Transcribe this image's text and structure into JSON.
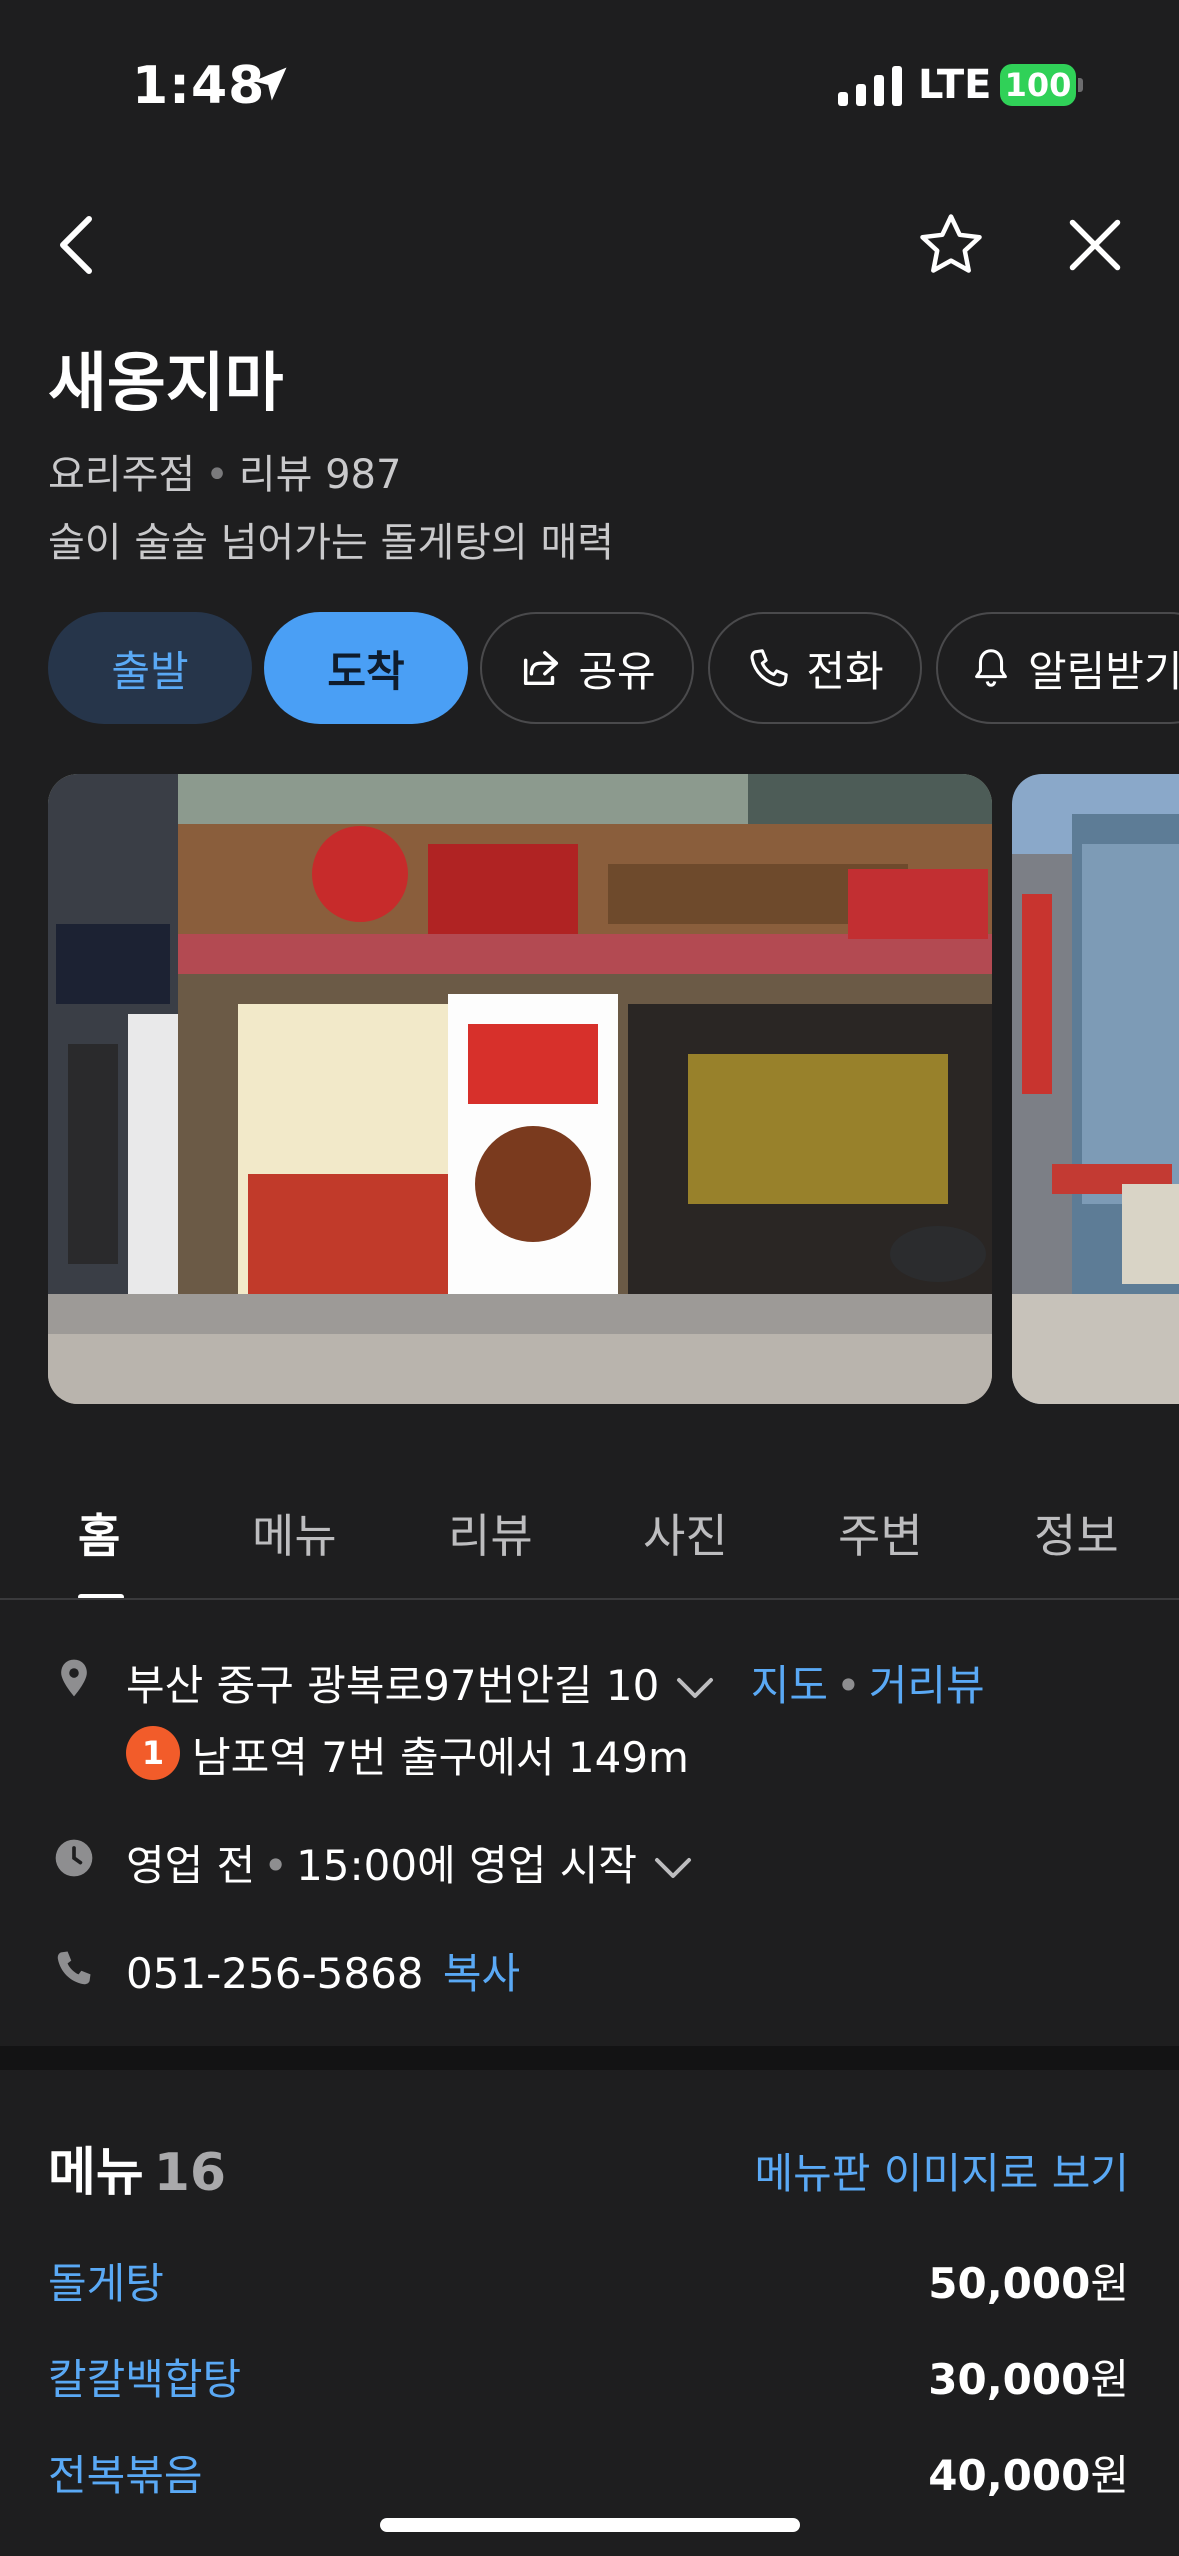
{
  "status_bar": {
    "time": "1:48",
    "network": "LTE",
    "battery": "100"
  },
  "place": {
    "name": "새옹지마",
    "category": "요리주점",
    "reviews_label": "리뷰 987",
    "tagline": "술이 술술 넘어가는 돌게탕의 매력"
  },
  "actions": {
    "depart": "출발",
    "arrive": "도착",
    "share": "공유",
    "call": "전화",
    "notify": "알림받기"
  },
  "tabs": [
    "홈",
    "메뉴",
    "리뷰",
    "사진",
    "주변",
    "정보"
  ],
  "info": {
    "address": "부산 중구 광복로97번안길 10",
    "map_link": "지도",
    "street_view_link": "거리뷰",
    "transit_badge": "1",
    "transit": "남포역 7번 출구에서 149m",
    "hours": "영업 전",
    "hours_detail": "15:00에 영업 시작",
    "phone": "051-256-5868",
    "copy_link": "복사"
  },
  "menu": {
    "title": "메뉴",
    "count": "16",
    "board_link": "메뉴판 이미지로 보기",
    "items": [
      {
        "name": "돌게탕",
        "price": "50,000",
        "unit": "원"
      },
      {
        "name": "칼칼백합탕",
        "price": "30,000",
        "unit": "원"
      },
      {
        "name": "전복볶음",
        "price": "40,000",
        "unit": "원"
      }
    ]
  },
  "icons": {
    "back": "chevron-left-icon",
    "favorite": "star-outline-icon",
    "close": "close-icon",
    "share": "share-icon",
    "call": "phone-icon",
    "notify": "bell-icon",
    "location": "location-pin-icon",
    "clock": "clock-icon",
    "phone": "phone-icon"
  },
  "colors": {
    "background": "#1e1e1f",
    "accent": "#4a9ff5",
    "link": "#5aa9f5",
    "badge": "#f25c2a",
    "battery": "#30d158"
  }
}
